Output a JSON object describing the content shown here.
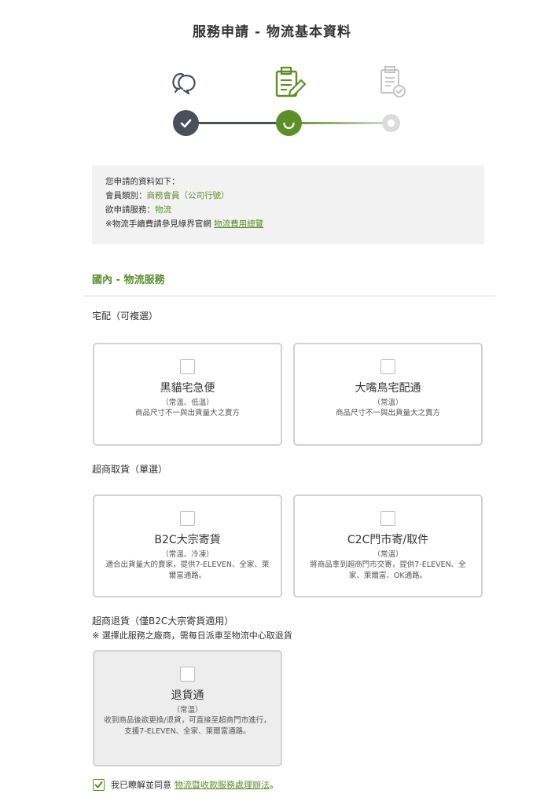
{
  "page": {
    "title": "服務申請 - 物流基本資料"
  },
  "steps": [
    {
      "icon": "chat-bubbles-icon",
      "state": "completed"
    },
    {
      "icon": "document-edit-icon",
      "state": "current"
    },
    {
      "icon": "document-check-icon",
      "state": "pending"
    }
  ],
  "colors": {
    "accent": "#5c8f27",
    "completed": "#4a4f5c",
    "pending": "#cccccc"
  },
  "info": {
    "intro": "您申請的資料如下：",
    "member_label": "會員類別：",
    "member_value": "商務會員（公司行號）",
    "service_label": "欲申請服務：",
    "service_value": "物流",
    "fee_note": "※物流手續費請參見綠界官網",
    "fee_link": "物流費用總覽"
  },
  "section": {
    "title": "國內 - 物流服務"
  },
  "home_delivery": {
    "label": "宅配（可複選）",
    "options": [
      {
        "name": "黑貓宅急便",
        "temp": "（常溫、低溫）",
        "desc": "商品尺寸不一與出貨量大之賣方",
        "checked": false
      },
      {
        "name": "大嘴鳥宅配通",
        "temp": "（常溫）",
        "desc": "商品尺寸不一與出貨量大之賣方",
        "checked": false
      }
    ]
  },
  "store_pickup": {
    "label": "超商取貨（單選）",
    "options": [
      {
        "name": "B2C大宗寄貨",
        "temp": "（常溫、冷凍）",
        "desc": "適合出貨量大的賣家，提供7-ELEVEN、全家、萊爾富通路。",
        "checked": false
      },
      {
        "name": "C2C門市寄/取件",
        "temp": "（常溫）",
        "desc": "將商品拿到超商門市交寄，提供7-ELEVEN、全家、萊爾富、OK通路。",
        "checked": false
      }
    ]
  },
  "store_return": {
    "label": "超商退貨（僅B2C大宗寄貨適用）",
    "note": "※ 選擇此服務之廠商，需每日派車至物流中心取退貨",
    "options": [
      {
        "name": "退貨通",
        "temp": "（常溫）",
        "desc": "收到商品後欲更換/退貨，可直接至超商門市進行，支援7-ELEVEN、全家、萊爾富通路。",
        "checked": false,
        "disabled": true
      }
    ]
  },
  "agreement": {
    "checked": true,
    "prefix": "我已瞭解並同意",
    "link": "物流暨收款服務處理辦法",
    "suffix": "。"
  }
}
